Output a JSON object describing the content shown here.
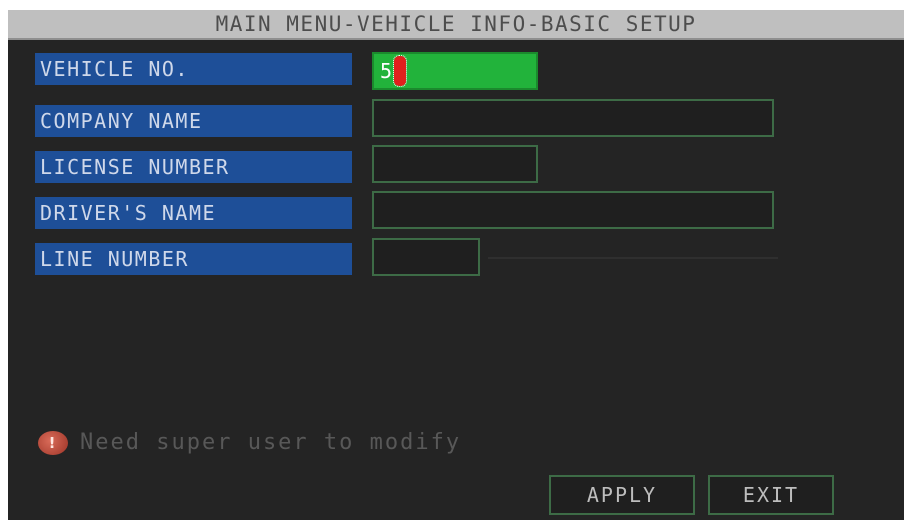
{
  "title": "MAIN MENU-VEHICLE INFO-BASIC SETUP",
  "fields": [
    {
      "label": "VEHICLE NO.",
      "value": "5"
    },
    {
      "label": "COMPANY NAME",
      "value": ""
    },
    {
      "label": "LICENSE NUMBER",
      "value": ""
    },
    {
      "label": "DRIVER'S NAME",
      "value": ""
    },
    {
      "label": "LINE NUMBER",
      "value": ""
    }
  ],
  "notice": {
    "icon": "warning-icon",
    "text": "Need super user to modify"
  },
  "buttons": {
    "apply": "APPLY",
    "exit": "EXIT"
  },
  "colors": {
    "label_bg": "#1e4f98",
    "active_field": "#22b33b",
    "field_border": "#3d6b46",
    "background": "#242424",
    "titlebar": "#bfbfbf",
    "cursor": "#e0201d"
  }
}
